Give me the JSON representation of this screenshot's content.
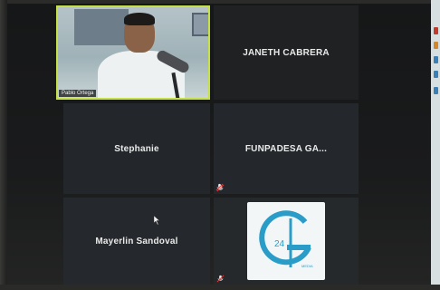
{
  "participants": [
    {
      "name": "Pablo Ortega",
      "has_video": true
    },
    {
      "name": "JANETH CABRERA",
      "has_video": false
    },
    {
      "name": "Stephanie",
      "has_video": false
    },
    {
      "name": "FUNPADESA  GA...",
      "has_video": false
    },
    {
      "name": "Mayerlin Sandoval",
      "has_video": false
    },
    {
      "name": "",
      "has_video": false,
      "logo_text": "24",
      "logo_sub": "MEDIA"
    }
  ],
  "colors": {
    "active_speaker_border": "#c6e04a",
    "tile_bg": "#222426",
    "logo_blue": "#2a9cc8"
  },
  "icons": {
    "muted": "microphone-muted-icon",
    "cursor": "mouse-pointer-icon"
  }
}
